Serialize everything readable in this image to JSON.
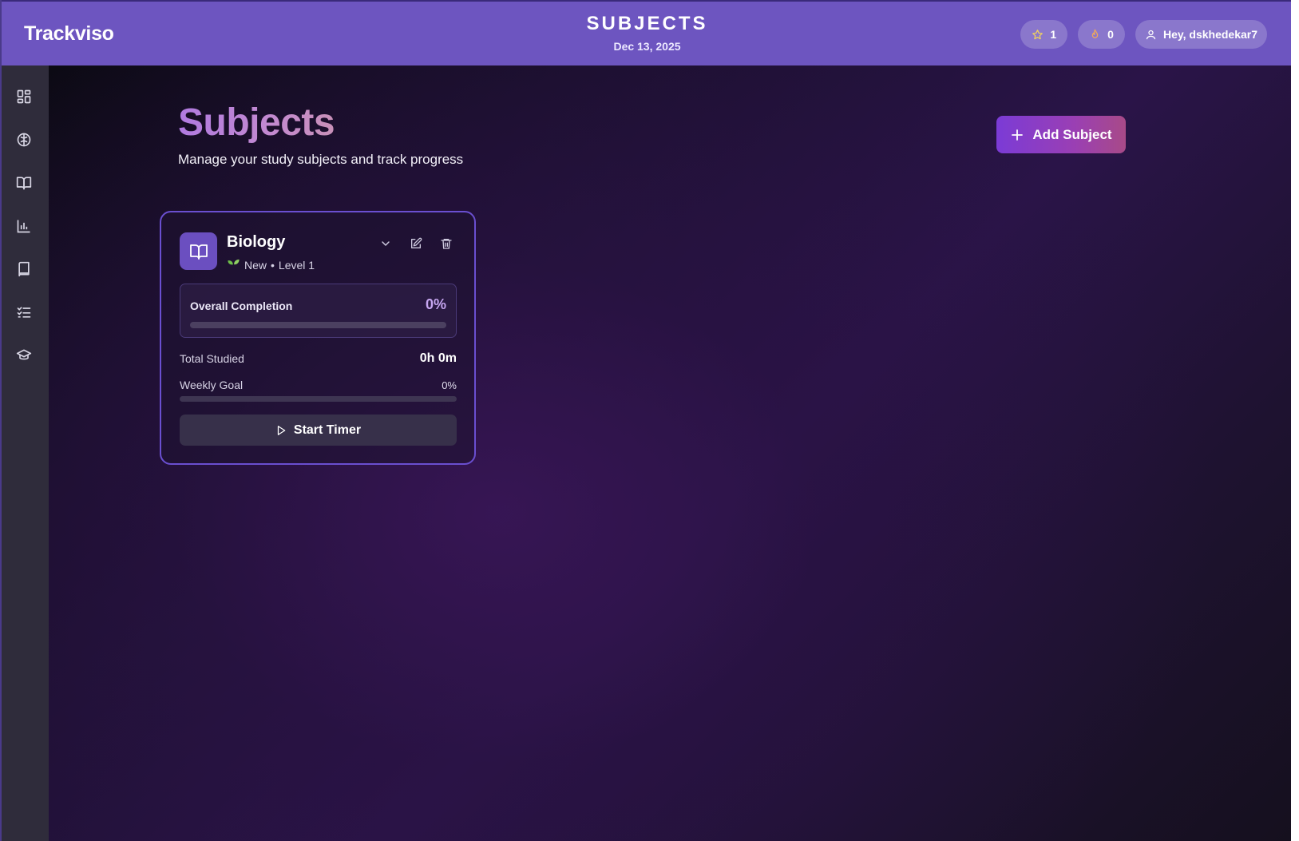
{
  "header": {
    "brand": "Trackviso",
    "title": "SUBJECTS",
    "date": "Dec 13, 2025",
    "stars_count": "1",
    "streak_count": "0",
    "user_greeting": "Hey, dskhedekar7"
  },
  "sidebar": {
    "items": [
      {
        "icon": "dashboard-icon"
      },
      {
        "icon": "brain-icon"
      },
      {
        "icon": "open-book-icon"
      },
      {
        "icon": "bar-chart-icon"
      },
      {
        "icon": "notebook-icon"
      },
      {
        "icon": "checklist-icon"
      },
      {
        "icon": "graduation-cap-icon"
      }
    ]
  },
  "main": {
    "title": "Subjects",
    "subtitle": "Manage your study subjects and track progress",
    "add_button_label": "Add Subject"
  },
  "subject_card": {
    "name": "Biology",
    "status": "New",
    "separator": "•",
    "level": "Level 1",
    "completion_label": "Overall Completion",
    "completion_value": "0%",
    "completion_fraction": 0,
    "total_studied_label": "Total Studied",
    "total_studied_value": "0h 0m",
    "weekly_goal_label": "Weekly Goal",
    "weekly_goal_value": "0%",
    "weekly_goal_fraction": 0,
    "start_timer_label": "Start Timer"
  },
  "colors": {
    "header_bg": "#6d55c0",
    "sidebar_bg": "#2f2c3b",
    "accent": "#7b3bd6",
    "card_border": "#6a4fd0"
  }
}
